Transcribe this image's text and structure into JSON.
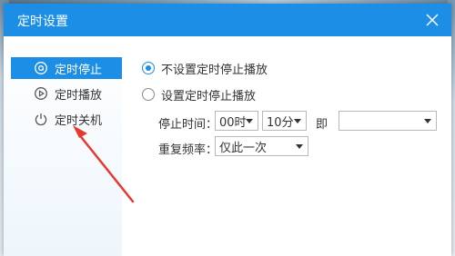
{
  "dialog": {
    "title": "定时设置"
  },
  "sidebar": {
    "items": [
      {
        "label": "定时停止",
        "icon": "timer-stop-icon",
        "active": true
      },
      {
        "label": "定时播放",
        "icon": "timer-play-icon",
        "active": false
      },
      {
        "label": "定时关机",
        "icon": "power-icon",
        "active": false
      }
    ]
  },
  "options": {
    "no_timer_label": "不设置定时停止播放",
    "set_timer_label": "设置定时停止播放",
    "selected": "no_timer"
  },
  "stop_time": {
    "label": "停止时间：",
    "hour": "00时",
    "minute": "10分",
    "ji_label": "即",
    "datetime": ""
  },
  "repeat": {
    "label": "重复频率：",
    "value": "仅此一次"
  },
  "colors": {
    "accent": "#1c8ee6",
    "annotation": "#e8392f"
  }
}
